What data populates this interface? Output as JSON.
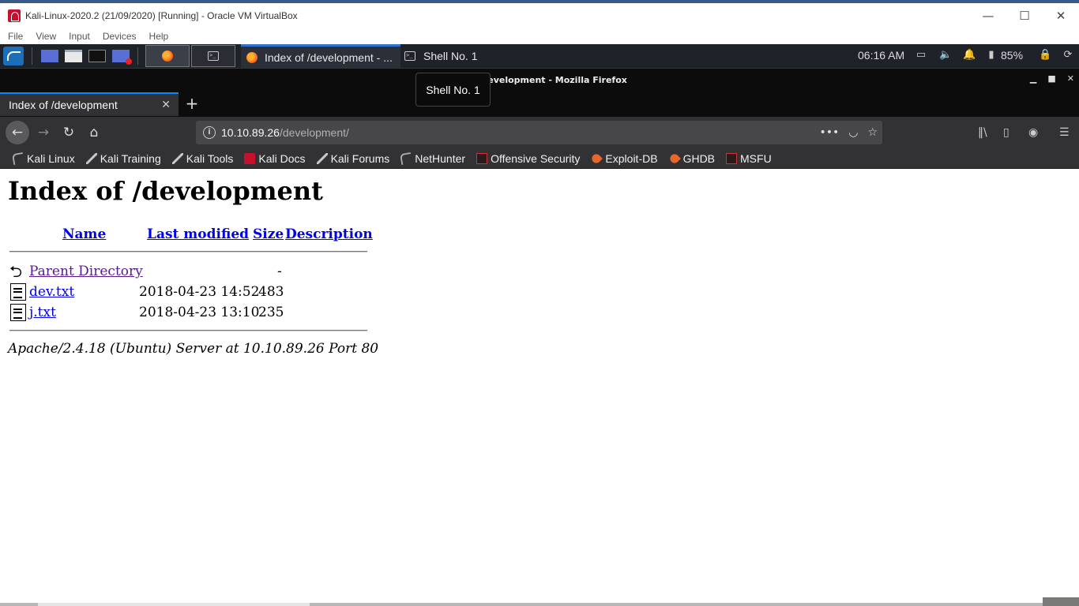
{
  "vbox": {
    "title": "Kali-Linux-2020.2 (21/09/2020) [Running] - Oracle VM VirtualBox",
    "menu": [
      "File",
      "View",
      "Input",
      "Devices",
      "Help"
    ],
    "controls": {
      "minimize": "—",
      "maximize": "☐",
      "close": "✕"
    }
  },
  "panel": {
    "tasks": [
      {
        "label": "Index of /development - ...",
        "icon": "firefox-icon",
        "active": true
      },
      {
        "label": "Shell No. 1",
        "icon": "terminal-icon",
        "active": false
      }
    ],
    "clock": "06:16 AM",
    "battery": "85%"
  },
  "firefox": {
    "window_title": "Index of /development - Mozilla Firefox",
    "tooltip": "Shell No. 1",
    "window_controls": {
      "minimize": "▁",
      "maximize": "■",
      "close": "✕"
    },
    "tab": {
      "label": "Index of /development",
      "close": "✕"
    },
    "new_tab": "+",
    "url": {
      "host": "10.10.89.26",
      "path": "/development/"
    },
    "bookmarks": [
      {
        "label": "Kali Linux",
        "icon": "kali-dragon-icon"
      },
      {
        "label": "Kali Training",
        "icon": "kali-sword-icon"
      },
      {
        "label": "Kali Tools",
        "icon": "kali-sword-icon"
      },
      {
        "label": "Kali Docs",
        "icon": "kali-docs-icon"
      },
      {
        "label": "Kali Forums",
        "icon": "kali-sword-icon"
      },
      {
        "label": "NetHunter",
        "icon": "kali-dragon-icon"
      },
      {
        "label": "Offensive Security",
        "icon": "offsec-icon"
      },
      {
        "label": "Exploit-DB",
        "icon": "exploit-db-icon"
      },
      {
        "label": "GHDB",
        "icon": "exploit-db-icon"
      },
      {
        "label": "MSFU",
        "icon": "offsec-icon"
      }
    ]
  },
  "page": {
    "heading": "Index of /development",
    "columns": {
      "name": "Name",
      "modified": "Last modified",
      "size": "Size",
      "description": "Description"
    },
    "rows": [
      {
        "name": "Parent Directory",
        "modified": "",
        "size": "-",
        "icon": "back-icon"
      },
      {
        "name": "dev.txt",
        "modified": "2018-04-23 14:52",
        "size": "483",
        "icon": "text-file-icon"
      },
      {
        "name": "j.txt",
        "modified": "2018-04-23 13:10",
        "size": "235",
        "icon": "text-file-icon"
      }
    ],
    "footer": "Apache/2.4.18 (Ubuntu) Server at 10.10.89.26 Port 80"
  }
}
